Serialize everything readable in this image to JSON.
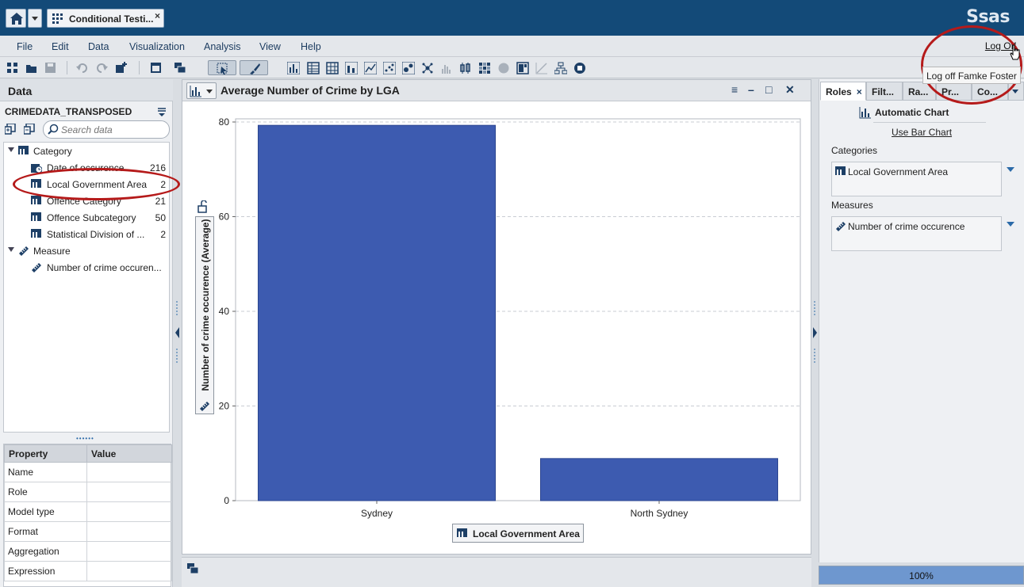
{
  "app": {
    "tab_title": "Conditional Testi...",
    "tab_close": "×",
    "brand": "Ssas"
  },
  "menu": {
    "items": [
      "File",
      "Edit",
      "Data",
      "Visualization",
      "Analysis",
      "View",
      "Help"
    ],
    "logoff": "Log Off",
    "logoff_tooltip": "Log off Famke Foster"
  },
  "toolbar": {
    "icons": [
      "new-report-icon",
      "open-icon",
      "save-icon",
      "undo-icon",
      "redo-icon",
      "insert-icon",
      "maximize-icon",
      "layers-icon",
      "select-icon",
      "brush-icon",
      "auto-chart-icon",
      "table-icon",
      "crosstab-icon",
      "bar-chart-icon",
      "line-chart-icon",
      "scatter-icon",
      "bubble-icon",
      "network-icon",
      "histogram-icon",
      "box-plot-icon",
      "heat-map-icon",
      "geo-map-icon",
      "treemap-icon",
      "correlation-icon",
      "decision-tree-icon",
      "forecast-icon"
    ]
  },
  "data_pane": {
    "title": "Data",
    "dataset": "CRIMEDATA_TRANSPOSED",
    "search_placeholder": "Search data",
    "tree": [
      {
        "label": "Category",
        "count": "",
        "icon": "category-folder-icon",
        "level": 0
      },
      {
        "label": "Date of occurence",
        "count": "216",
        "icon": "date-icon",
        "level": 1
      },
      {
        "label": "Local Government Area",
        "count": "2",
        "icon": "category-icon",
        "level": 1
      },
      {
        "label": "Offence Category",
        "count": "21",
        "icon": "category-icon",
        "level": 1
      },
      {
        "label": "Offence Subcategory",
        "count": "50",
        "icon": "category-icon",
        "level": 1
      },
      {
        "label": "Statistical Division of ...",
        "count": "2",
        "icon": "category-icon",
        "level": 1
      },
      {
        "label": "Measure",
        "count": "",
        "icon": "measure-folder-icon",
        "level": 0
      },
      {
        "label": "Number of crime occuren...",
        "count": "",
        "icon": "measure-icon",
        "level": 1
      }
    ],
    "properties": {
      "headers": [
        "Property",
        "Value"
      ],
      "rows": [
        [
          "Name",
          ""
        ],
        [
          "Role",
          ""
        ],
        [
          "Model type",
          ""
        ],
        [
          "Format",
          ""
        ],
        [
          "Aggregation",
          ""
        ],
        [
          "Expression",
          ""
        ]
      ]
    }
  },
  "chart_panel": {
    "title": "Average Number of Crime by LGA",
    "controls": [
      "≡",
      "–",
      "□",
      "✕"
    ]
  },
  "chart_data": {
    "type": "bar",
    "title": "Average Number of Crime by LGA",
    "categories": [
      "Sydney",
      "North Sydney"
    ],
    "values": [
      79.3,
      8.9
    ],
    "xlabel": "Local Government Area",
    "ylabel": "Number of crime occurence (Average)",
    "ylim": [
      0,
      80
    ],
    "yticks": [
      0,
      20,
      40,
      60,
      80
    ],
    "grid": true,
    "color": "#3d5bb0"
  },
  "roles_pane": {
    "tabs": [
      {
        "label": "Roles",
        "close": "×"
      },
      {
        "label": "Filt..."
      },
      {
        "label": "Ra..."
      },
      {
        "label": "Pr..."
      },
      {
        "label": "Co..."
      }
    ],
    "auto_chart": "Automatic Chart",
    "use_bar": "Use Bar Chart",
    "categories_label": "Categories",
    "categories_value": "Local Government Area",
    "measures_label": "Measures",
    "measures_value": "Number of crime occurence"
  },
  "status": {
    "progress": 1.0,
    "progress_text": "100%"
  },
  "colors": {
    "title_bar": "#134a78",
    "annotation": "#b51a1a",
    "bar": "#3d5bb0"
  }
}
